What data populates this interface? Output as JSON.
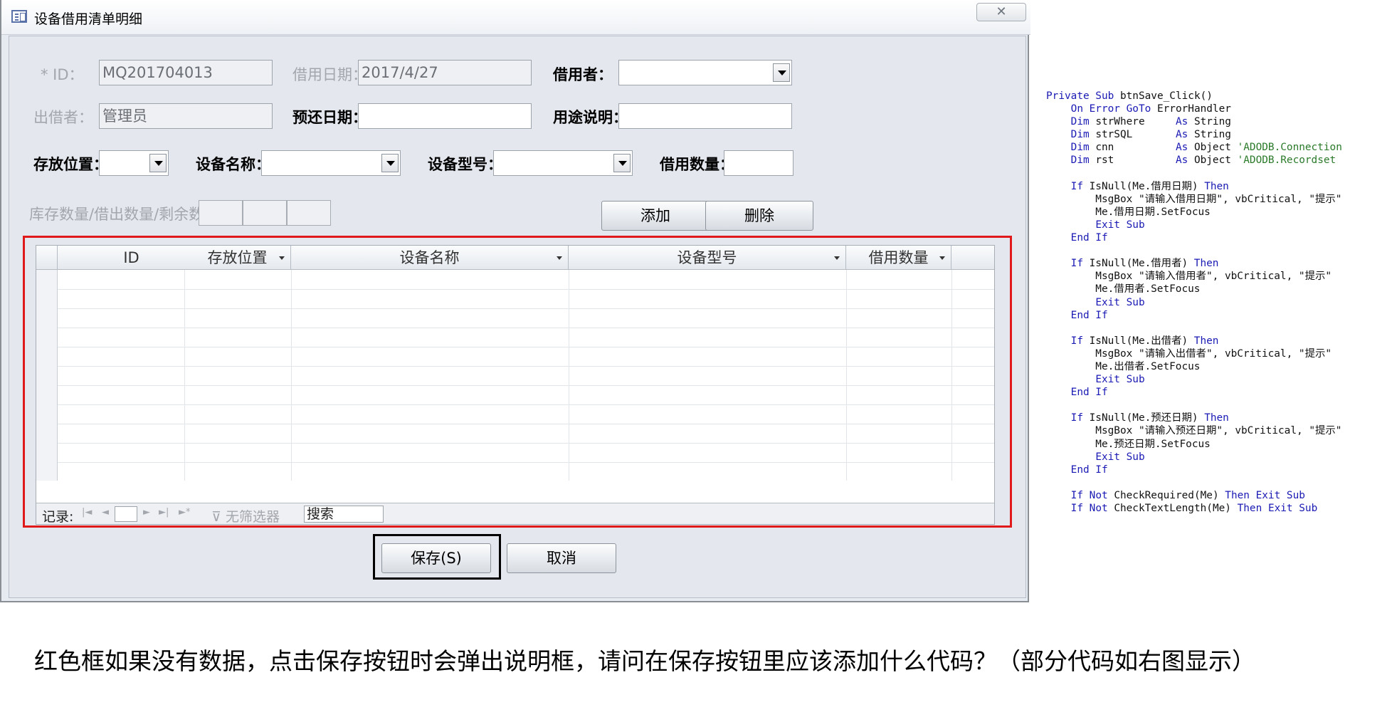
{
  "window": {
    "title": "设备借用清单明细",
    "close_glyph": "✕"
  },
  "form": {
    "id_label": "* ID：",
    "id_value": "MQ201704013",
    "borrow_date_label": "借用日期：",
    "borrow_date_value": "2017/4/27",
    "borrower_label": "借用者：",
    "lender_label": "出借者：",
    "lender_value": "管理员",
    "return_date_label": "预还日期：",
    "purpose_label": "用途说明：",
    "location_label": "存放位置：",
    "device_name_label": "设备名称：",
    "device_model_label": "设备型号：",
    "borrow_qty_label": "借用数量：",
    "stock_label": "库存数量/借出数量/剩余数量：",
    "add_button": "添加",
    "delete_button": "删除",
    "save_button": "保存(S)",
    "cancel_button": "取消"
  },
  "grid": {
    "columns": [
      "ID",
      "存放位置",
      "设备名称",
      "设备型号",
      "借用数量"
    ],
    "nav": {
      "record_label": "记录:",
      "filter_label": "无筛选器",
      "search_value": "搜索"
    }
  },
  "code_lines": [
    "Private Sub btnSave_Click()",
    "    On Error GoTo ErrorHandler",
    "    Dim strWhere     As String",
    "    Dim strSQL       As String",
    "    Dim cnn          As Object 'ADODB.Connection",
    "    Dim rst          As Object 'ADODB.Recordset",
    "",
    "    If IsNull(Me.借用日期) Then",
    "        MsgBox \"请输入借用日期\", vbCritical, \"提示\"",
    "        Me.借用日期.SetFocus",
    "        Exit Sub",
    "    End If",
    "",
    "    If IsNull(Me.借用者) Then",
    "        MsgBox \"请输入借用者\", vbCritical, \"提示\"",
    "        Me.借用者.SetFocus",
    "        Exit Sub",
    "    End If",
    "",
    "    If IsNull(Me.出借者) Then",
    "        MsgBox \"请输入出借者\", vbCritical, \"提示\"",
    "        Me.出借者.SetFocus",
    "        Exit Sub",
    "    End If",
    "",
    "    If IsNull(Me.预还日期) Then",
    "        MsgBox \"请输入预还日期\", vbCritical, \"提示\"",
    "        Me.预还日期.SetFocus",
    "        Exit Sub",
    "    End If",
    "",
    "    If Not CheckRequired(Me) Then Exit Sub",
    "    If Not CheckTextLength(Me) Then Exit Sub"
  ],
  "question": "红色框如果没有数据，点击保存按钮时会弹出说明框，请问在保存按钮里应该添加什么代码？（部分代码如右图显示）",
  "colors": {
    "highlight_frame": "#e01a1a",
    "code_keyword": "#1a1ab4",
    "code_comment": "#2a7a2a"
  }
}
